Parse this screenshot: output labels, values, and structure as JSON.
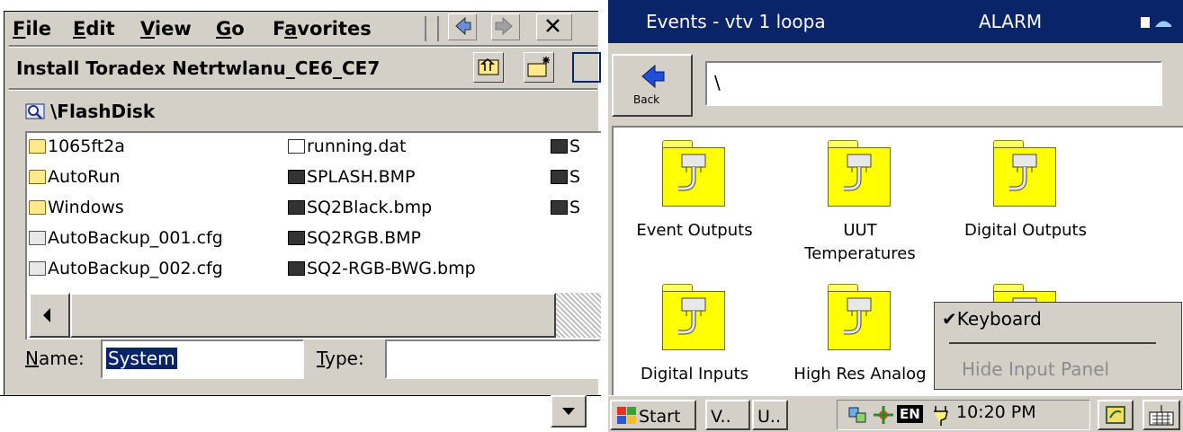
{
  "left": {
    "top_cut_text": "",
    "menu": [
      {
        "label": "File",
        "u": "F",
        "rest": "ile"
      },
      {
        "label": "Edit",
        "u": "E",
        "rest": "dit"
      },
      {
        "label": "View",
        "u": "V",
        "rest": "iew"
      },
      {
        "label": "Go",
        "u": "G",
        "rest": "o"
      },
      {
        "label": "Favorites",
        "u": "a",
        "pre": "F",
        "rest": "vorites"
      }
    ],
    "dialog_title": "Install Toradex Netrtwlanu_CE6_CE7",
    "path": "\\FlashDisk",
    "files_col1": [
      "1065ft2a",
      "AutoRun",
      "Windows",
      "AutoBackup_001.cfg",
      "AutoBackup_002.cfg"
    ],
    "files_col2": [
      "running.dat",
      "SPLASH.BMP",
      "SQ2Black.bmp",
      "SQ2RGB.BMP",
      "SQ2-RGB-BWG.bmp"
    ],
    "files_col3": [
      "S",
      "S",
      "S"
    ],
    "name_label": "Name:",
    "name_value": "System",
    "type_label": "Type:",
    "type_value": ""
  },
  "right": {
    "title": "Events - vtv 1 loopa",
    "status": "ALARM",
    "back_label": "Back",
    "address": "\\",
    "folders": [
      "Event Outputs",
      "UUT Temperatures",
      "Digital Outputs",
      "Digital Inputs",
      "High Res Analog",
      ""
    ],
    "popup": {
      "keyboard": "Keyboard",
      "hide": "Hide Input Panel"
    },
    "taskbar": {
      "start": "Start",
      "btn1": "V..",
      "btn2": "U..",
      "lang": "EN",
      "clock": "10:20 PM"
    }
  },
  "colors": {
    "titlebar": "#0a246a",
    "chrome": "#d4d0c8",
    "folder": "#ffff00",
    "selection": "#0a246a"
  }
}
